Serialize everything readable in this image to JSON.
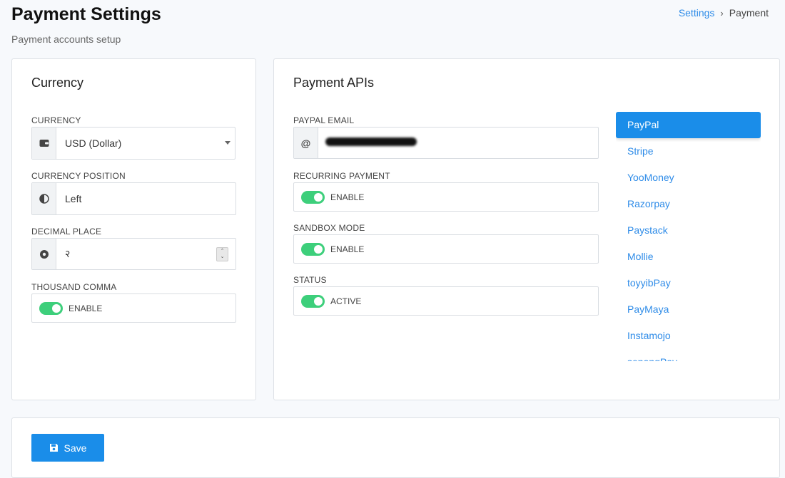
{
  "header": {
    "title": "Payment Settings",
    "subtitle": "Payment accounts setup",
    "breadcrumb": {
      "parent": "Settings",
      "current": "Payment"
    }
  },
  "currency_card": {
    "title": "Currency",
    "currency": {
      "label": "CURRENCY",
      "value": "USD (Dollar)",
      "icon": "wallet-icon"
    },
    "position": {
      "label": "CURRENCY POSITION",
      "value": "Left",
      "icon": "half-circle-icon"
    },
    "decimal": {
      "label": "DECIMAL PLACE",
      "value": "२",
      "icon": "dot-circle-icon"
    },
    "thousand_comma": {
      "label": "THOUSAND COMMA",
      "toggle_label": "ENABLE",
      "enabled": true
    }
  },
  "apis_card": {
    "title": "Payment APIs",
    "paypal_email": {
      "label": "PAYPAL EMAIL",
      "icon": "at-icon"
    },
    "recurring": {
      "label": "RECURRING PAYMENT",
      "toggle_label": "ENABLE",
      "enabled": true
    },
    "sandbox": {
      "label": "SANDBOX MODE",
      "toggle_label": "ENABLE",
      "enabled": true
    },
    "status": {
      "label": "STATUS",
      "toggle_label": "ACTIVE",
      "enabled": true
    },
    "gateways": [
      "PayPal",
      "Stripe",
      "YooMoney",
      "Razorpay",
      "Paystack",
      "Mollie",
      "toyyibPay",
      "PayMaya",
      "Instamojo",
      "senangPay"
    ],
    "active_gateway": "PayPal"
  },
  "footer": {
    "save_label": "Save",
    "icon": "floppy-disk-icon"
  },
  "colors": {
    "accent": "#1a8de9",
    "link": "#2f8ce8",
    "toggle_on": "#3dcf7b"
  }
}
